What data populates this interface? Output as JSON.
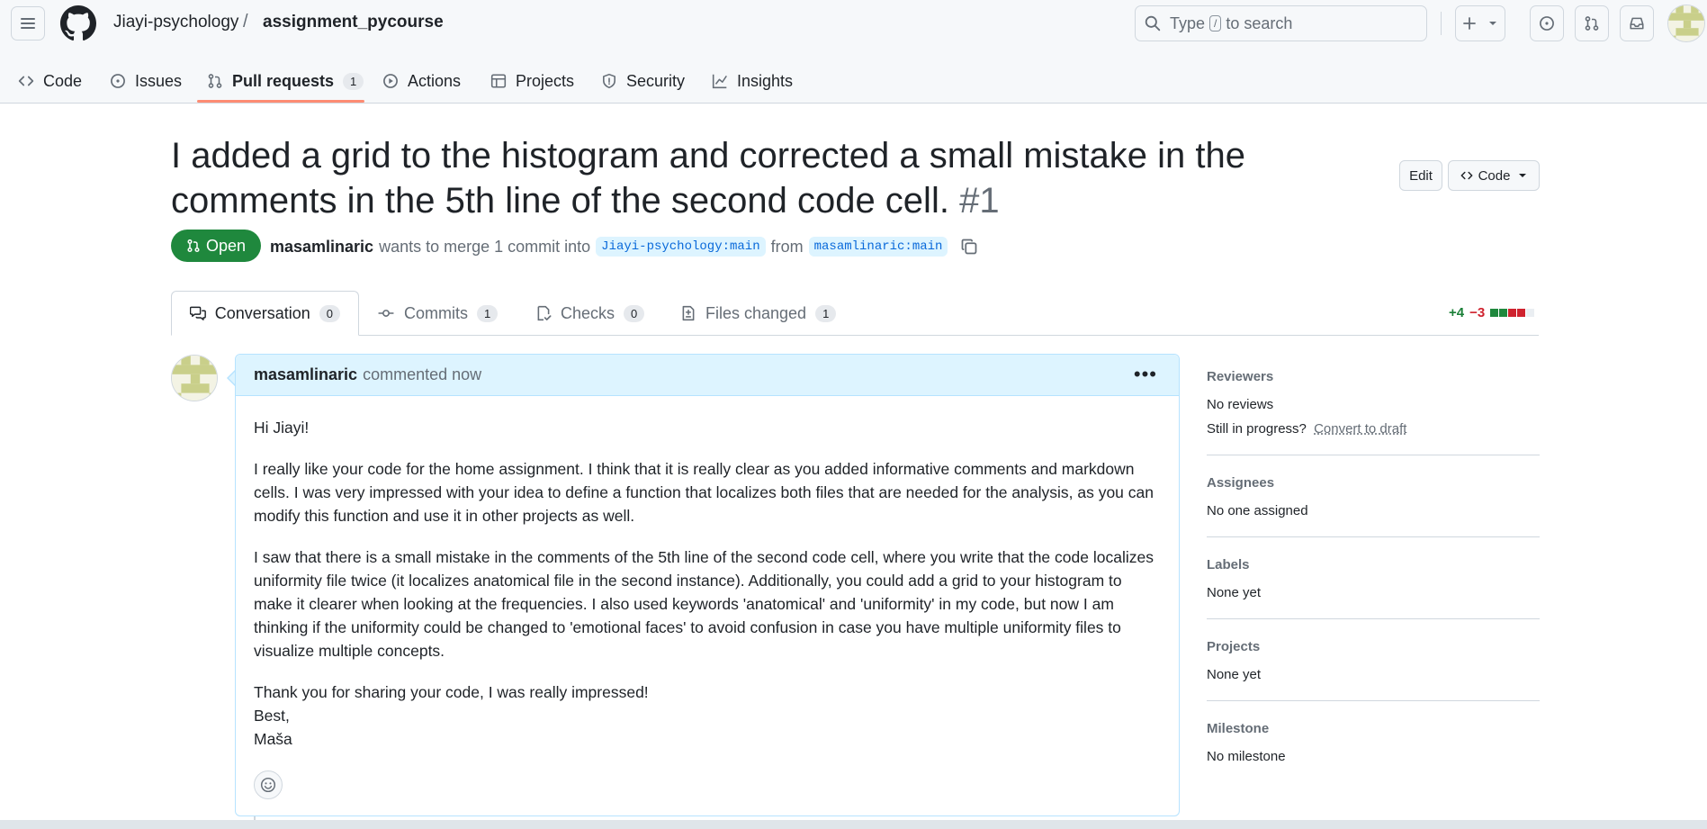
{
  "header": {
    "owner": "Jiayi-psychology",
    "separator": "/",
    "repo": "assignment_pycourse",
    "search_prefix": "Type",
    "search_key": "/",
    "search_suffix": "to search"
  },
  "repo_nav": {
    "items": [
      {
        "label": "Code",
        "icon": "code-icon"
      },
      {
        "label": "Issues",
        "icon": "issue-icon"
      },
      {
        "label": "Pull requests",
        "icon": "pull-request-icon",
        "count": "1",
        "active": true
      },
      {
        "label": "Actions",
        "icon": "play-icon"
      },
      {
        "label": "Projects",
        "icon": "table-icon"
      },
      {
        "label": "Security",
        "icon": "shield-icon"
      },
      {
        "label": "Insights",
        "icon": "graph-icon"
      }
    ]
  },
  "pr": {
    "title": "I added a grid to the histogram and corrected a small mistake in the comments in the 5th line of the second code cell.",
    "number": "#1",
    "edit_label": "Edit",
    "code_label": "Code",
    "state": "Open",
    "author": "masamlinaric",
    "merge_text": "wants to merge 1 commit into",
    "base_branch": "Jiayi-psychology:main",
    "from_text": "from",
    "head_branch": "masamlinaric:main"
  },
  "tabs": [
    {
      "label": "Conversation",
      "count": "0",
      "icon": "comment-discussion-icon"
    },
    {
      "label": "Commits",
      "count": "1",
      "icon": "commit-icon"
    },
    {
      "label": "Checks",
      "count": "0",
      "icon": "checklist-icon"
    },
    {
      "label": "Files changed",
      "count": "1",
      "icon": "file-diff-icon"
    }
  ],
  "diffstat": {
    "additions": "+4",
    "deletions": "−3"
  },
  "comment": {
    "author": "masamlinaric",
    "meta": "commented now",
    "paragraphs": [
      "Hi Jiayi!",
      "I really like your code for the home assignment. I think that it is really clear as you added informative comments and markdown cells. I was very impressed with your idea to define a function that localizes both files that are needed for the analysis, as you can modify this function and use it in other projects as well.",
      "I saw that there is a small mistake in the comments of the 5th line of the second code cell, where you write that the code localizes uniformity file twice (it localizes anatomical file in the second instance). Additionally, you could add a grid to your histogram to make it clearer when looking at the frequencies. I also used keywords 'anatomical' and 'uniformity' in my code, but now I am thinking if the uniformity could be changed to 'emotional faces' to avoid confusion in case you have multiple uniformity files to visualize multiple concepts."
    ],
    "closing_1": "Thank you for sharing your code, I was really impressed!",
    "closing_2": "Best,",
    "closing_3": "Maša"
  },
  "sidebar": {
    "reviewers_head": "Reviewers",
    "reviewers_val": "No reviews",
    "progress_text": "Still in progress?",
    "progress_link": "Convert to draft",
    "assignees_head": "Assignees",
    "assignees_val": "No one assigned",
    "labels_head": "Labels",
    "labels_val": "None yet",
    "projects_head": "Projects",
    "projects_val": "None yet",
    "milestone_head": "Milestone",
    "milestone_val": "No milestone"
  },
  "colors": {
    "open_green": "#1f883d",
    "accent_blue": "#0969da",
    "nav_underline": "#fd8c73",
    "comment_header_bg": "#ddf4ff"
  }
}
